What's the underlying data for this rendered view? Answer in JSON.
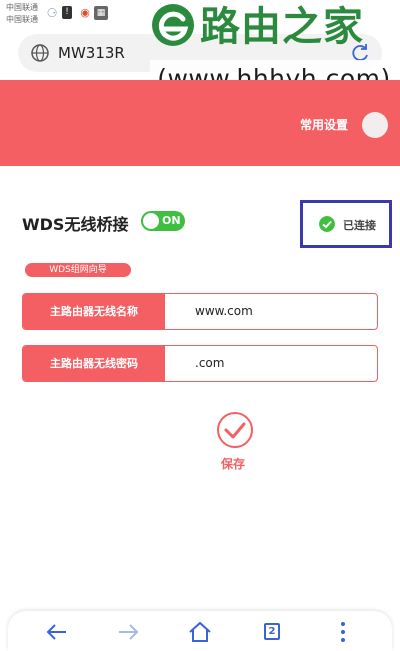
{
  "status_bar": {
    "carrier_1": "中国联通",
    "carrier_2": "中国联通"
  },
  "watermark": {
    "title": "路由之家",
    "url": "(www.hhhyh.com)"
  },
  "address_bar": {
    "url": "MW313R"
  },
  "header": {
    "tab_label": "常用设置"
  },
  "wds": {
    "label": "WDS无线桥接",
    "toggle_label": "ON",
    "toggle_on": true,
    "status": "已连接"
  },
  "wizard": {
    "label": "WDS组网向导"
  },
  "fields": {
    "ssid": {
      "label": "主路由器无线名称",
      "value": "www.com"
    },
    "password": {
      "label": "主路由器无线密码",
      "value": ".com"
    }
  },
  "save": {
    "label": "保存"
  },
  "bottom_nav": {
    "tab_count": "2"
  },
  "colors": {
    "accent": "#f45f64",
    "toggle_on": "#3fbf3f",
    "nav_blue": "#3b63d6",
    "highlight_box": "#3b3aa8",
    "watermark_green": "#2c8a3e"
  },
  "icons": [
    "globe-icon",
    "refresh-icon",
    "check-icon",
    "save-check-icon",
    "back-arrow-icon",
    "forward-arrow-icon",
    "home-icon",
    "tabs-icon",
    "more-menu-icon"
  ]
}
